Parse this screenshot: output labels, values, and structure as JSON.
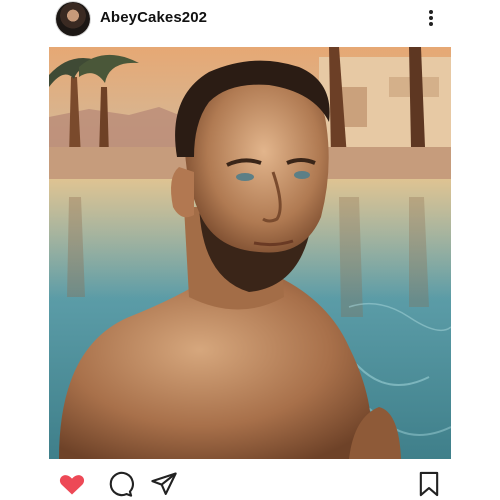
{
  "post": {
    "username": "AbeyCakes202",
    "avatar_icon": "avatar-portrait",
    "more_icon": "more-vertical-icon",
    "image_subject": "",
    "actions": {
      "like_icon": "heart-icon",
      "like_state": "liked",
      "like_color": "#ED4956",
      "comment_icon": "comment-icon",
      "share_icon": "send-icon",
      "save_icon": "bookmark-icon"
    }
  }
}
